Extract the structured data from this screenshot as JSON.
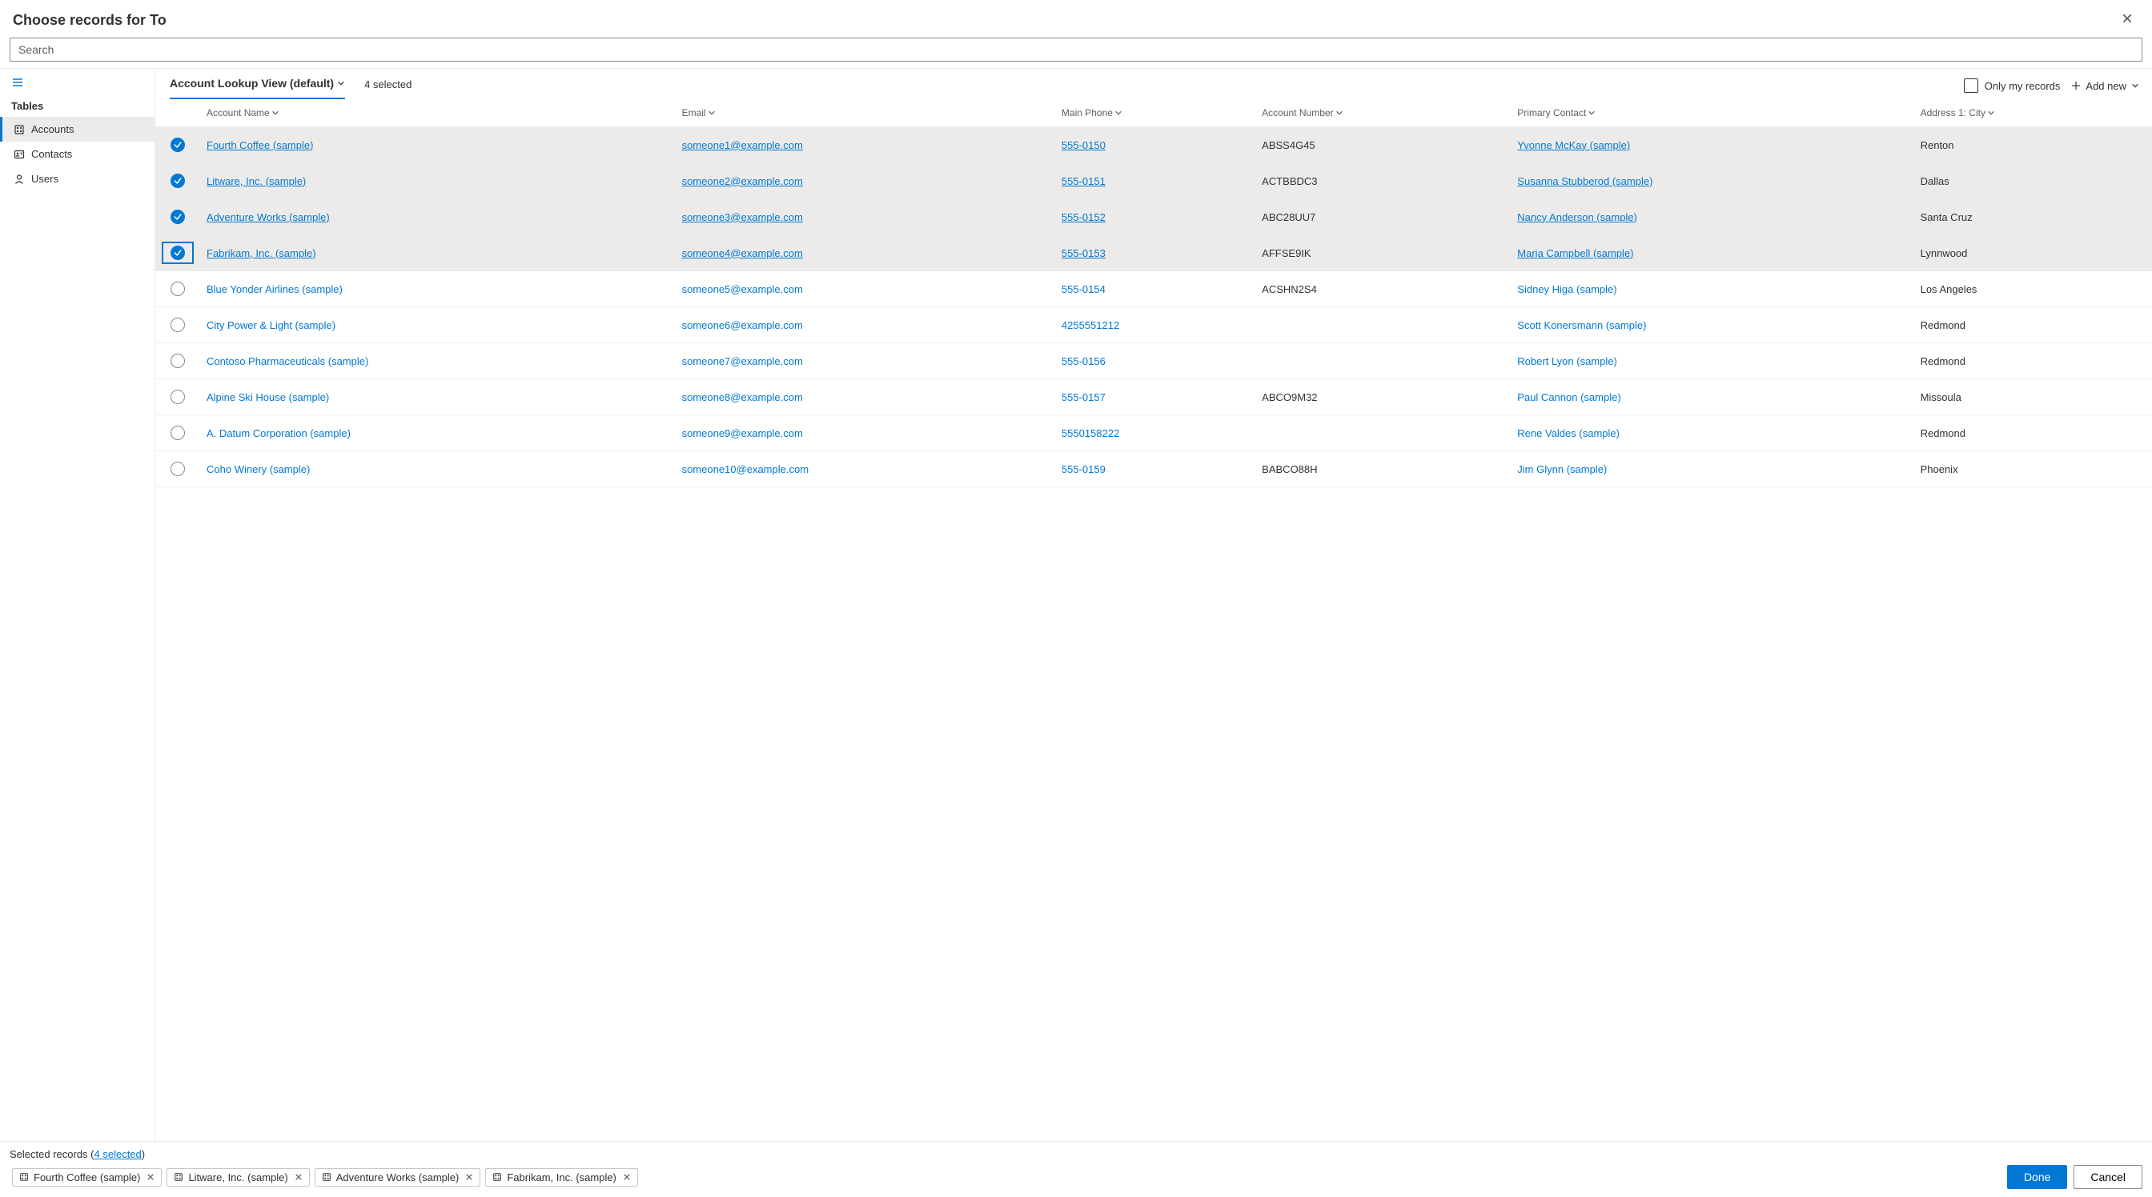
{
  "dialog": {
    "title": "Choose records for To"
  },
  "search": {
    "placeholder": "Search",
    "value": ""
  },
  "sidebar": {
    "heading": "Tables",
    "items": [
      {
        "label": "Accounts",
        "selected": true,
        "icon": "account"
      },
      {
        "label": "Contacts",
        "selected": false,
        "icon": "contact"
      },
      {
        "label": "Users",
        "selected": false,
        "icon": "user"
      }
    ]
  },
  "toolbar": {
    "view_name": "Account Lookup View (default)",
    "selected_count": "4 selected",
    "only_my_records": "Only my records",
    "add_new": "Add new"
  },
  "columns": [
    {
      "label": "Account Name"
    },
    {
      "label": "Email"
    },
    {
      "label": "Main Phone"
    },
    {
      "label": "Account Number"
    },
    {
      "label": "Primary Contact"
    },
    {
      "label": "Address 1: City"
    }
  ],
  "rows": [
    {
      "selected": true,
      "focused": false,
      "name": "Fourth Coffee (sample)",
      "email": "someone1@example.com",
      "phone": "555-0150",
      "acct": "ABSS4G45",
      "contact": "Yvonne McKay (sample)",
      "city": "Renton"
    },
    {
      "selected": true,
      "focused": false,
      "name": "Litware, Inc. (sample)",
      "email": "someone2@example.com",
      "phone": "555-0151",
      "acct": "ACTBBDC3",
      "contact": "Susanna Stubberod (sample)",
      "city": "Dallas"
    },
    {
      "selected": true,
      "focused": false,
      "name": "Adventure Works (sample)",
      "email": "someone3@example.com",
      "phone": "555-0152",
      "acct": "ABC28UU7",
      "contact": "Nancy Anderson (sample)",
      "city": "Santa Cruz"
    },
    {
      "selected": true,
      "focused": true,
      "name": "Fabrikam, Inc. (sample)",
      "email": "someone4@example.com",
      "phone": "555-0153",
      "acct": "AFFSE9IK",
      "contact": "Maria Campbell (sample)",
      "city": "Lynnwood"
    },
    {
      "selected": false,
      "focused": false,
      "name": "Blue Yonder Airlines (sample)",
      "email": "someone5@example.com",
      "phone": "555-0154",
      "acct": "ACSHN2S4",
      "contact": "Sidney Higa (sample)",
      "city": "Los Angeles"
    },
    {
      "selected": false,
      "focused": false,
      "name": "City Power & Light (sample)",
      "email": "someone6@example.com",
      "phone": "4255551212",
      "acct": "",
      "contact": "Scott Konersmann (sample)",
      "city": "Redmond"
    },
    {
      "selected": false,
      "focused": false,
      "name": "Contoso Pharmaceuticals (sample)",
      "email": "someone7@example.com",
      "phone": "555-0156",
      "acct": "",
      "contact": "Robert Lyon (sample)",
      "city": "Redmond"
    },
    {
      "selected": false,
      "focused": false,
      "name": "Alpine Ski House (sample)",
      "email": "someone8@example.com",
      "phone": "555-0157",
      "acct": "ABCO9M32",
      "contact": "Paul Cannon (sample)",
      "city": "Missoula"
    },
    {
      "selected": false,
      "focused": false,
      "name": "A. Datum Corporation (sample)",
      "email": "someone9@example.com",
      "phone": "5550158222",
      "acct": "",
      "contact": "Rene Valdes (sample)",
      "city": "Redmond"
    },
    {
      "selected": false,
      "focused": false,
      "name": "Coho Winery (sample)",
      "email": "someone10@example.com",
      "phone": "555-0159",
      "acct": "BABCO88H",
      "contact": "Jim Glynn (sample)",
      "city": "Phoenix"
    }
  ],
  "footer": {
    "label_prefix": "Selected records (",
    "label_link": "4 selected",
    "label_suffix": ")",
    "chips": [
      "Fourth Coffee (sample)",
      "Litware, Inc. (sample)",
      "Adventure Works (sample)",
      "Fabrikam, Inc. (sample)"
    ],
    "done": "Done",
    "cancel": "Cancel"
  }
}
